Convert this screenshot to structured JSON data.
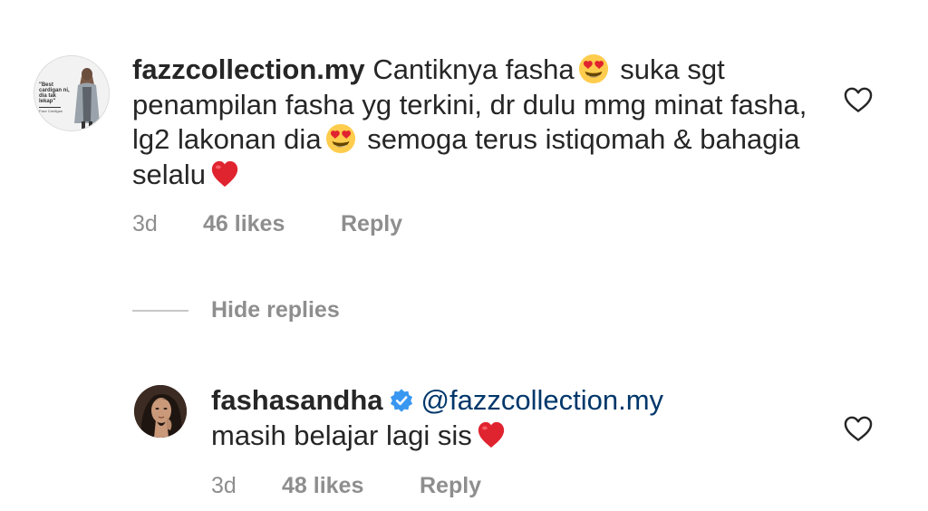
{
  "comment": {
    "username": "fazzcollection.my",
    "lines": [
      "Cantiknya fasha",
      "suka",
      "sgt penampilan fasha yg terkini, dr dulu mmg",
      "minat fasha, lg2 lakonan dia",
      "semoga terus",
      "istiqomah & bahagia selalu"
    ],
    "time": "3d",
    "likes": "46 likes",
    "reply_label": "Reply",
    "avatar_text": {
      "l1": "\"Best",
      "l2": "cardigan ni,",
      "l3": "dia tak",
      "l4": "lekap\"",
      "l5": "Fazz Cardigan"
    }
  },
  "replies_toggle": {
    "label": "Hide replies"
  },
  "reply": {
    "username": "fashasandha",
    "mention": "@fazzcollection.my",
    "text": "masih belajar lagi sis",
    "time": "3d",
    "likes": "48 likes",
    "reply_label": "Reply"
  },
  "icons": {
    "heart_outline": "heart-outline-icon",
    "heart_emoji": "red-heart-emoji",
    "heart_eyes_emoji": "heart-eyes-emoji",
    "verified": "verified-badge-icon"
  },
  "colors": {
    "text": "#262626",
    "muted": "#8e8e8e",
    "mention": "#00376b",
    "verified": "#3897f0",
    "heart_red": "#e0242f"
  }
}
